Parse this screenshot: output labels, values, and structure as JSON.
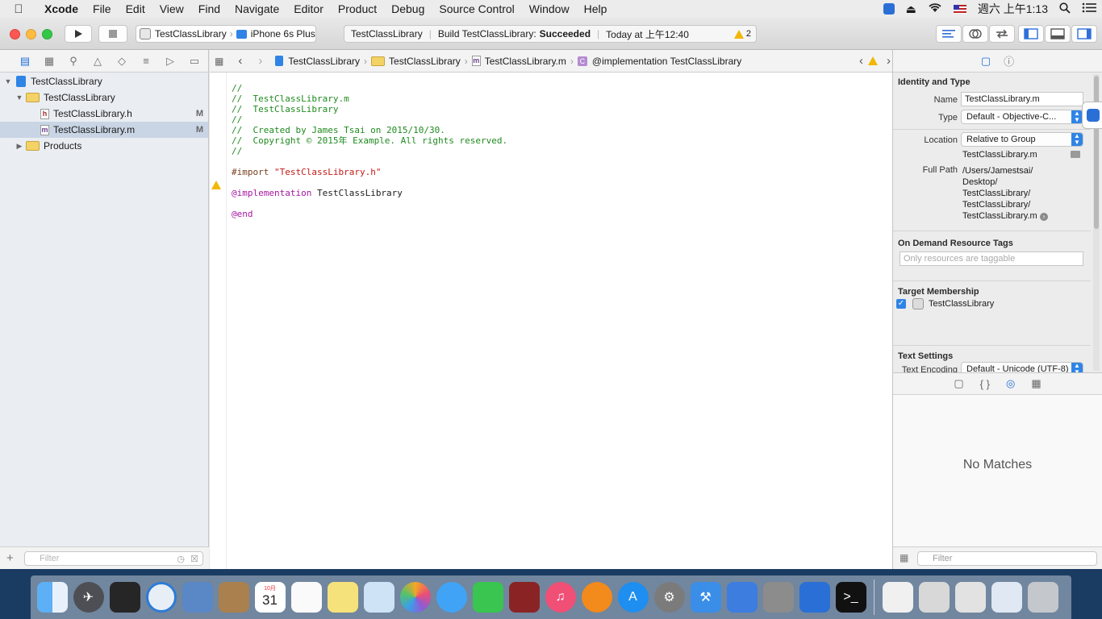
{
  "menubar": {
    "apple": "",
    "items": [
      "Xcode",
      "File",
      "Edit",
      "View",
      "Find",
      "Navigate",
      "Editor",
      "Product",
      "Debug",
      "Source Control",
      "Window",
      "Help"
    ],
    "clock": "週六 上午1:13"
  },
  "toolbar": {
    "scheme": "TestClassLibrary",
    "destination": "iPhone 6s Plus",
    "activity_project": "TestClassLibrary",
    "activity_build_prefix": "Build TestClassLibrary:",
    "activity_build_status": "Succeeded",
    "activity_time": "Today at 上午12:40",
    "warning_count": "2"
  },
  "navigator": {
    "tree": [
      {
        "label": "TestClassLibrary",
        "level": 0,
        "type": "project",
        "expanded": true
      },
      {
        "label": "TestClassLibrary",
        "level": 1,
        "type": "folder",
        "expanded": true
      },
      {
        "label": "TestClassLibrary.h",
        "level": 2,
        "type": "header",
        "badge": "M"
      },
      {
        "label": "TestClassLibrary.m",
        "level": 2,
        "type": "source",
        "badge": "M",
        "selected": true
      },
      {
        "label": "Products",
        "level": 1,
        "type": "folder",
        "expanded": false
      }
    ],
    "filter_placeholder": "Filter"
  },
  "jumpbar": {
    "crumbs": [
      "TestClassLibrary",
      "TestClassLibrary",
      "TestClassLibrary.m",
      "@implementation TestClassLibrary"
    ]
  },
  "code": {
    "lines": [
      {
        "t": "//",
        "c": "cmt"
      },
      {
        "t": "//  TestClassLibrary.m",
        "c": "cmt"
      },
      {
        "t": "//  TestClassLibrary",
        "c": "cmt"
      },
      {
        "t": "//",
        "c": "cmt"
      },
      {
        "t": "//  Created by James Tsai on 2015/10/30.",
        "c": "cmt"
      },
      {
        "t": "//  Copyright © 2015年 Example. All rights reserved.",
        "c": "cmt"
      },
      {
        "t": "//",
        "c": "cmt"
      },
      {
        "t": "",
        "c": ""
      },
      {
        "t": "#import ",
        "c": "pre",
        "extra": "\"TestClassLibrary.h\"",
        "extra_c": "str"
      },
      {
        "t": "",
        "c": ""
      },
      {
        "t": "@implementation",
        "c": "kw",
        "extra": " TestClassLibrary",
        "extra_c": ""
      },
      {
        "t": "",
        "c": ""
      },
      {
        "t": "@end",
        "c": "kw"
      }
    ]
  },
  "inspector": {
    "identity_title": "Identity and Type",
    "name_label": "Name",
    "name_value": "TestClassLibrary.m",
    "type_label": "Type",
    "type_value": "Default - Objective-C...",
    "location_label": "Location",
    "location_value": "Relative to Group",
    "location_file": "TestClassLibrary.m",
    "fullpath_label": "Full Path",
    "fullpath_lines": [
      "/Users/Jamestsai/",
      "Desktop/",
      "TestClassLibrary/",
      "TestClassLibrary/",
      "TestClassLibrary.m"
    ],
    "odr_title": "On Demand Resource Tags",
    "odr_placeholder": "Only resources are taggable",
    "target_title": "Target Membership",
    "target_name": "TestClassLibrary",
    "text_settings_title": "Text Settings",
    "text_encoding_label": "Text Encoding",
    "text_encoding_value": "Default - Unicode (UTF-8)",
    "no_matches": "No Matches",
    "lib_filter_placeholder": "Filter"
  },
  "dock": {
    "icons": [
      "finder-icon",
      "launchpad-icon",
      "photo-booth-icon",
      "safari-icon",
      "mail-icon",
      "contacts-icon",
      "calendar-icon",
      "reminders-icon",
      "notes-icon",
      "preview-icon",
      "photos-icon",
      "messages-icon",
      "facetime-icon",
      "photo-app-icon",
      "itunes-icon",
      "ibooks-icon",
      "app-store-icon",
      "system-preferences-icon",
      "xcode-icon",
      "instruments-icon",
      "simulator-icon",
      "teamviewer-icon",
      "terminal-icon"
    ],
    "calendar_day": "31",
    "calendar_month": "10月"
  }
}
